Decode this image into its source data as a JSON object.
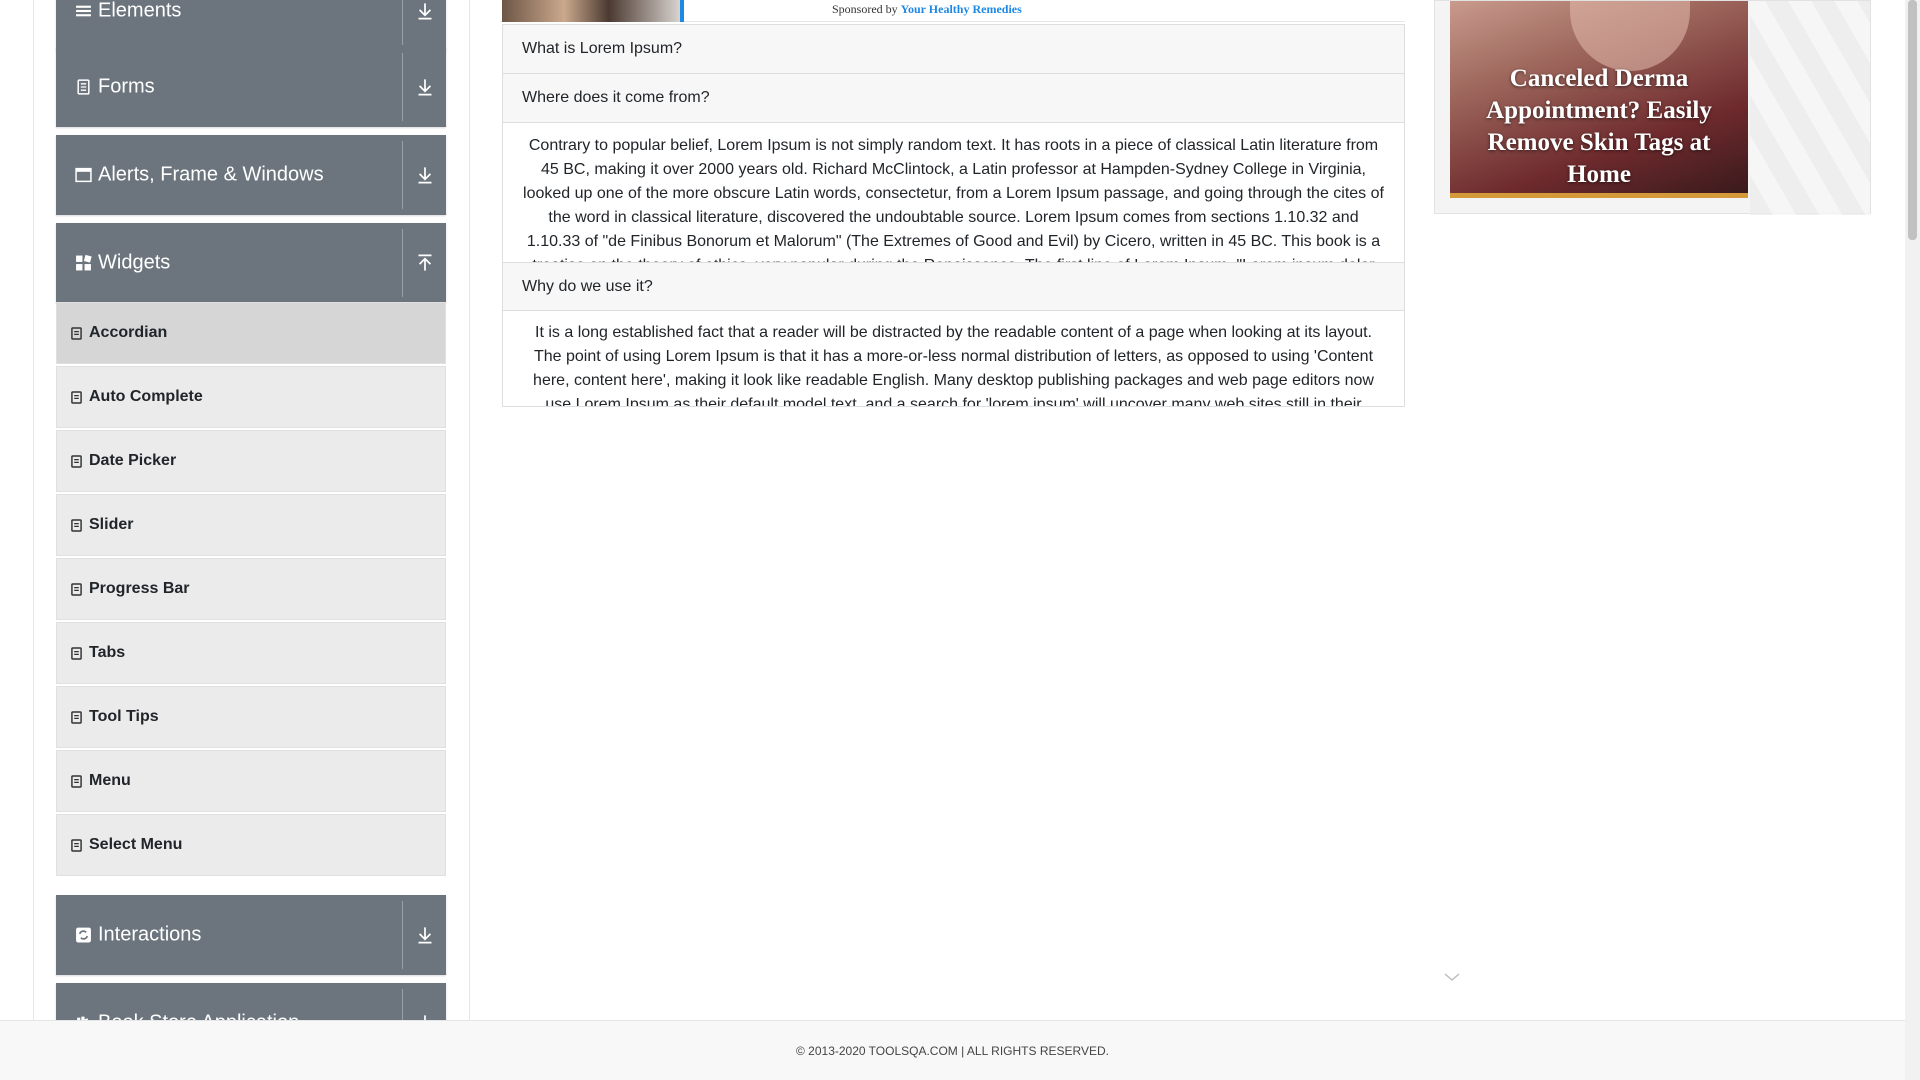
{
  "sidebar": {
    "groups": [
      {
        "label": "Elements",
        "icon": "elements-icon",
        "toggle": "expand-down-icon"
      },
      {
        "label": "Forms",
        "icon": "forms-icon",
        "toggle": "expand-down-icon"
      },
      {
        "label": "Alerts, Frame & Windows",
        "icon": "window-icon",
        "toggle": "expand-down-icon"
      },
      {
        "label": "Widgets",
        "icon": "widgets-icon",
        "toggle": "collapse-up-icon"
      },
      {
        "label": "Interactions",
        "icon": "interactions-icon",
        "toggle": "expand-down-icon"
      },
      {
        "label": "Book Store Application",
        "icon": "bookstore-icon",
        "toggle": "expand-down-icon"
      }
    ],
    "widget_items": [
      {
        "label": "Accordian",
        "active": true
      },
      {
        "label": "Auto Complete"
      },
      {
        "label": "Date Picker"
      },
      {
        "label": "Slider"
      },
      {
        "label": "Progress Bar"
      },
      {
        "label": "Tabs"
      },
      {
        "label": "Tool Tips"
      },
      {
        "label": "Menu"
      },
      {
        "label": "Select Menu"
      }
    ]
  },
  "top_ad": {
    "sponsored_prefix": "Sponsored by",
    "sponsor": "Your Healthy Remedies"
  },
  "accordion": [
    {
      "title": "What is Lorem Ipsum?"
    },
    {
      "title": "Where does it come from?",
      "body": "Contrary to popular belief, Lorem Ipsum is not simply random text. It has roots in a piece of classical Latin literature from 45 BC, making it over 2000 years old. Richard McClintock, a Latin professor at Hampden-Sydney College in Virginia, looked up one of the more obscure Latin words, consectetur, from a Lorem Ipsum passage, and going through the cites of the word in classical literature, discovered the undoubtable source. Lorem Ipsum comes from sections 1.10.32 and 1.10.33 of \"de Finibus Bonorum et Malorum\" (The Extremes of Good and Evil) by Cicero, written in 45 BC. This book is a treatise on the theory of ethics, very popular during the Renaissance. The first line of Lorem Ipsum, \"Lorem ipsum dolor"
    },
    {
      "title": "Why do we use it?",
      "body": "It is a long established fact that a reader will be distracted by the readable content of a page when looking at its layout. The point of using Lorem Ipsum is that it has a more-or-less normal distribution of letters, as opposed to using 'Content here, content here', making it look like readable English. Many desktop publishing packages and web page editors now use Lorem Ipsum as their default model text, and a search for 'lorem ipsum' will uncover many web sites still in their"
    }
  ],
  "right_ad": {
    "headline": "Canceled Derma Appointment? Easily Remove Skin Tags at Home"
  },
  "footer": {
    "text": "© 2013-2020 TOOLSQA.COM | ALL RIGHTS RESERVED."
  },
  "colors": {
    "group_header_bg": "#6c757d",
    "menu_item_bg": "#ebebeb",
    "menu_item_active_bg": "#d6d6d6",
    "sponsor_link": "#1e88e5",
    "ad_accent": "#d49a3a"
  }
}
